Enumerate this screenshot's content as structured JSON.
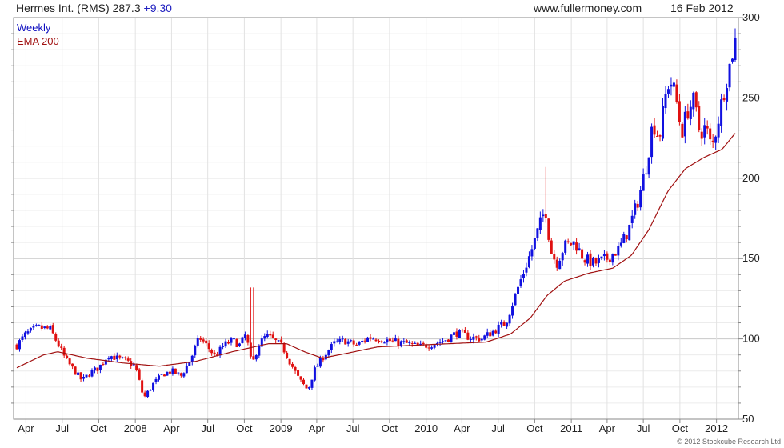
{
  "header": {
    "security": "Hermes Int. (RMS)",
    "last_price": "287.3",
    "change": "+9.30",
    "website": "www.fullermoney.com",
    "date": "16 Feb 2012"
  },
  "legend": {
    "weekly": "Weekly",
    "ema": "EMA 200"
  },
  "credit": "© 2012 Stockcube Research Ltd",
  "colors": {
    "up": "#1010e0",
    "down": "#e01010",
    "ema": "#a01010",
    "grid": "#d8d8d8",
    "change": "#2020c0"
  },
  "chart_data": {
    "type": "candlestick",
    "title": "Hermes Int. (RMS)",
    "ylim": [
      50,
      300
    ],
    "y_ticks": [
      50,
      100,
      150,
      200,
      250,
      300
    ],
    "x_range": [
      "2007-03-09",
      "2012-02-17"
    ],
    "x_ticks": [
      {
        "label": "Apr",
        "date": "2007-04-01"
      },
      {
        "label": "Jul",
        "date": "2007-07-01"
      },
      {
        "label": "Oct",
        "date": "2007-10-01"
      },
      {
        "label": "2008",
        "date": "2008-01-01"
      },
      {
        "label": "Apr",
        "date": "2008-04-01"
      },
      {
        "label": "Jul",
        "date": "2008-07-01"
      },
      {
        "label": "Oct",
        "date": "2008-10-01"
      },
      {
        "label": "2009",
        "date": "2009-01-01"
      },
      {
        "label": "Apr",
        "date": "2009-04-01"
      },
      {
        "label": "Jul",
        "date": "2009-07-01"
      },
      {
        "label": "Oct",
        "date": "2009-10-01"
      },
      {
        "label": "2010",
        "date": "2010-01-01"
      },
      {
        "label": "Apr",
        "date": "2010-04-01"
      },
      {
        "label": "Jul",
        "date": "2010-07-01"
      },
      {
        "label": "Oct",
        "date": "2010-10-01"
      },
      {
        "label": "2011",
        "date": "2011-01-01"
      },
      {
        "label": "Apr",
        "date": "2011-04-01"
      },
      {
        "label": "Jul",
        "date": "2011-07-01"
      },
      {
        "label": "Oct",
        "date": "2011-10-01"
      },
      {
        "label": "2012",
        "date": "2012-01-01"
      }
    ],
    "price_anchors": [
      [
        "2007-03-09",
        96
      ],
      [
        "2007-04-01",
        103
      ],
      [
        "2007-05-01",
        107
      ],
      [
        "2007-06-01",
        106
      ],
      [
        "2007-06-20",
        97
      ],
      [
        "2007-07-10",
        87
      ],
      [
        "2007-08-01",
        80
      ],
      [
        "2007-08-20",
        74
      ],
      [
        "2007-09-10",
        79
      ],
      [
        "2007-10-01",
        82
      ],
      [
        "2007-10-25",
        90
      ],
      [
        "2007-11-15",
        88
      ],
      [
        "2007-12-10",
        86
      ],
      [
        "2008-01-01",
        83
      ],
      [
        "2008-01-22",
        63
      ],
      [
        "2008-02-15",
        72
      ],
      [
        "2008-03-10",
        78
      ],
      [
        "2008-04-01",
        80
      ],
      [
        "2008-04-25",
        77
      ],
      [
        "2008-05-20",
        88
      ],
      [
        "2008-06-10",
        101
      ],
      [
        "2008-07-01",
        95
      ],
      [
        "2008-07-20",
        89
      ],
      [
        "2008-08-10",
        96
      ],
      [
        "2008-09-01",
        99
      ],
      [
        "2008-09-20",
        96
      ],
      [
        "2008-10-05",
        103
      ],
      [
        "2008-10-20",
        83
      ],
      [
        "2008-11-05",
        96
      ],
      [
        "2008-11-25",
        102
      ],
      [
        "2008-12-15",
        99
      ],
      [
        "2009-01-05",
        95
      ],
      [
        "2009-01-25",
        85
      ],
      [
        "2009-02-15",
        75
      ],
      [
        "2009-03-10",
        68
      ],
      [
        "2009-03-25",
        80
      ],
      [
        "2009-04-20",
        90
      ],
      [
        "2009-05-15",
        97
      ],
      [
        "2009-06-10",
        99
      ],
      [
        "2009-07-10",
        96
      ],
      [
        "2009-08-10",
        101
      ],
      [
        "2009-09-10",
        100
      ],
      [
        "2009-10-15",
        98
      ],
      [
        "2009-11-15",
        97
      ],
      [
        "2009-12-15",
        95
      ],
      [
        "2010-01-20",
        97
      ],
      [
        "2010-02-15",
        99
      ],
      [
        "2010-03-20",
        104
      ],
      [
        "2010-04-20",
        101
      ],
      [
        "2010-05-20",
        100
      ],
      [
        "2010-06-20",
        105
      ],
      [
        "2010-07-20",
        110
      ],
      [
        "2010-08-20",
        132
      ],
      [
        "2010-09-20",
        153
      ],
      [
        "2010-10-15",
        172
      ],
      [
        "2010-10-28",
        181
      ],
      [
        "2010-11-10",
        155
      ],
      [
        "2010-11-25",
        147
      ],
      [
        "2010-12-15",
        158
      ],
      [
        "2011-01-10",
        160
      ],
      [
        "2011-02-01",
        150
      ],
      [
        "2011-03-01",
        147
      ],
      [
        "2011-04-01",
        150
      ],
      [
        "2011-05-01",
        156
      ],
      [
        "2011-05-25",
        168
      ],
      [
        "2011-06-20",
        188
      ],
      [
        "2011-07-10",
        210
      ],
      [
        "2011-07-25",
        235
      ],
      [
        "2011-08-10",
        225
      ],
      [
        "2011-08-25",
        250
      ],
      [
        "2011-09-05",
        262
      ],
      [
        "2011-09-20",
        252
      ],
      [
        "2011-10-05",
        228
      ],
      [
        "2011-10-20",
        242
      ],
      [
        "2011-11-05",
        248
      ],
      [
        "2011-11-20",
        228
      ],
      [
        "2011-12-05",
        232
      ],
      [
        "2011-12-20",
        218
      ],
      [
        "2012-01-05",
        236
      ],
      [
        "2012-01-20",
        255
      ],
      [
        "2012-02-05",
        272
      ],
      [
        "2012-02-17",
        287.3
      ]
    ],
    "ema_anchors": [
      [
        "2007-03-09",
        82
      ],
      [
        "2007-05-15",
        90
      ],
      [
        "2007-06-20",
        92
      ],
      [
        "2007-09-01",
        88
      ],
      [
        "2007-12-01",
        85
      ],
      [
        "2008-03-01",
        83
      ],
      [
        "2008-06-01",
        86
      ],
      [
        "2008-09-01",
        92
      ],
      [
        "2008-12-01",
        97
      ],
      [
        "2009-01-15",
        97
      ],
      [
        "2009-03-01",
        92
      ],
      [
        "2009-04-15",
        88
      ],
      [
        "2009-06-15",
        91
      ],
      [
        "2009-09-01",
        95
      ],
      [
        "2009-12-01",
        96
      ],
      [
        "2010-03-01",
        97
      ],
      [
        "2010-06-01",
        98
      ],
      [
        "2010-08-01",
        103
      ],
      [
        "2010-09-20",
        113
      ],
      [
        "2010-11-01",
        127
      ],
      [
        "2010-12-15",
        136
      ],
      [
        "2011-02-15",
        141
      ],
      [
        "2011-04-15",
        144
      ],
      [
        "2011-06-01",
        152
      ],
      [
        "2011-07-15",
        168
      ],
      [
        "2011-09-01",
        192
      ],
      [
        "2011-10-15",
        206
      ],
      [
        "2011-12-01",
        213
      ],
      [
        "2012-01-15",
        218
      ],
      [
        "2012-02-17",
        228
      ]
    ],
    "spikes": [
      [
        "2010-10-28",
        207
      ],
      [
        "2008-10-20",
        132
      ]
    ]
  }
}
